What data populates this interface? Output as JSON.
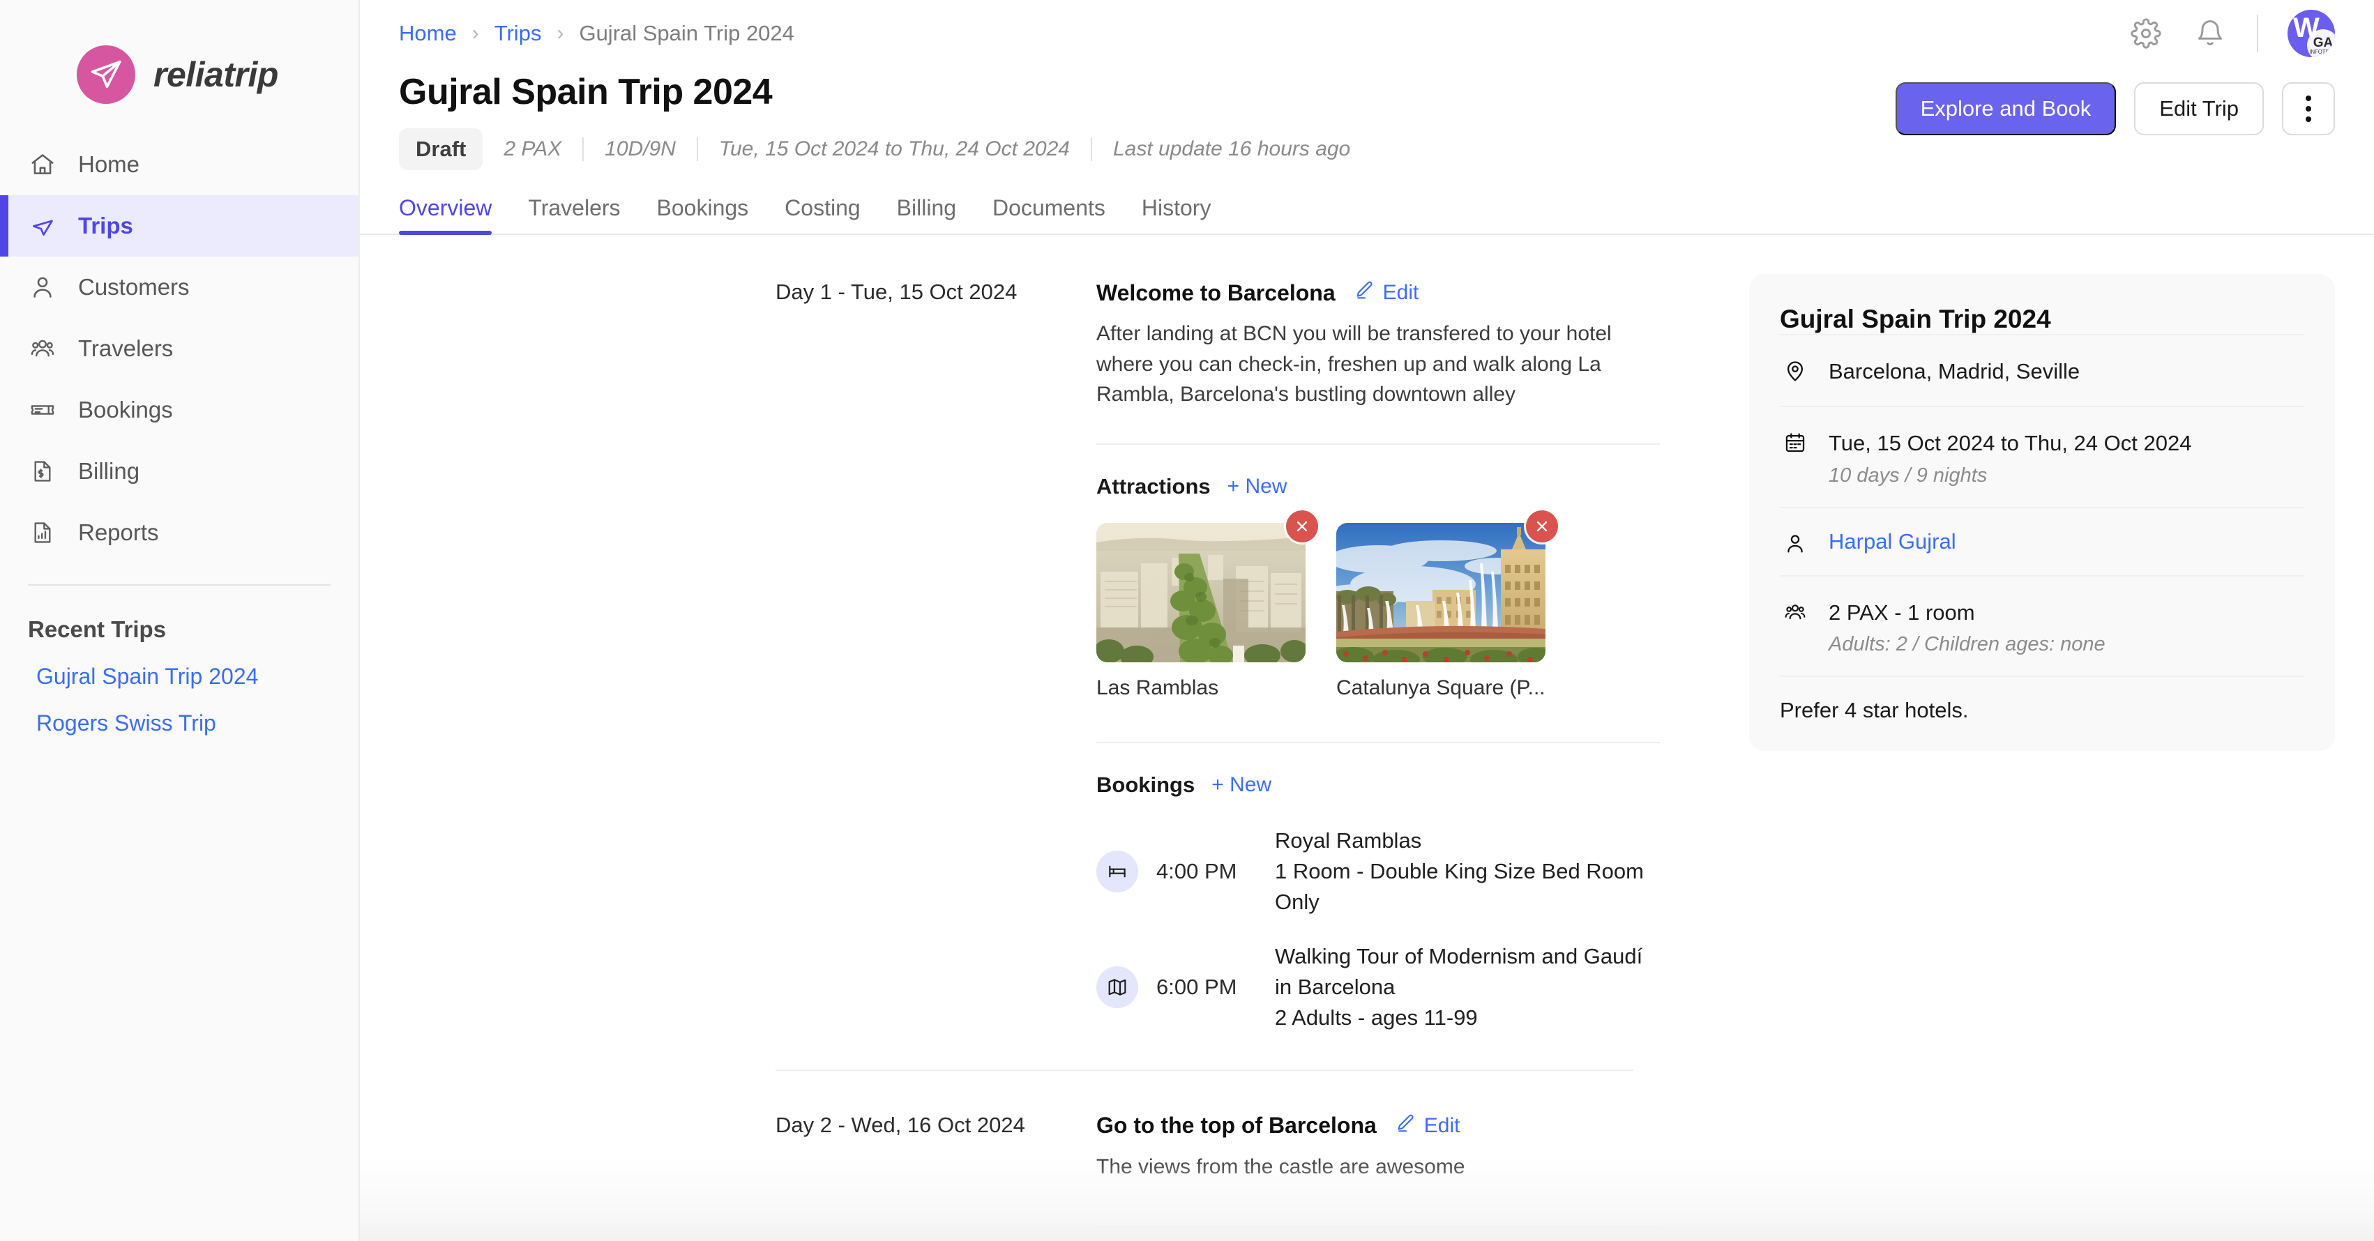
{
  "brand": {
    "name": "reliatrip",
    "logo_icon": "paper-plane-icon",
    "logo_color": "#d6579f"
  },
  "sidebar": {
    "nav": [
      {
        "label": "Home",
        "icon": "home-icon",
        "active": false
      },
      {
        "label": "Trips",
        "icon": "paper-plane-icon",
        "active": true
      },
      {
        "label": "Customers",
        "icon": "user-icon",
        "active": false
      },
      {
        "label": "Travelers",
        "icon": "users-group-icon",
        "active": false
      },
      {
        "label": "Bookings",
        "icon": "ticket-icon",
        "active": false
      },
      {
        "label": "Billing",
        "icon": "document-dollar-icon",
        "active": false
      },
      {
        "label": "Reports",
        "icon": "document-chart-icon",
        "active": false
      }
    ],
    "recent_title": "Recent Trips",
    "recent": [
      {
        "label": "Gujral Spain Trip 2024"
      },
      {
        "label": "Rogers Swiss Trip"
      }
    ]
  },
  "topbar": {
    "breadcrumb": [
      {
        "label": "Home",
        "link": true
      },
      {
        "label": "Trips",
        "link": true
      },
      {
        "label": "Gujral Spain Trip 2024",
        "link": false
      }
    ],
    "separator": "›",
    "settings_icon": "gear-icon",
    "notifications_icon": "bell-icon",
    "avatar_letter": "W",
    "avatar_badge_top": "GA",
    "avatar_badge_bottom": "INFOTECH",
    "avatar_color": "#6a5df0"
  },
  "header": {
    "title": "Gujral Spain Trip 2024",
    "status": "Draft",
    "meta": [
      "2 PAX",
      "10D/9N",
      "Tue, 15 Oct 2024 to Thu, 24 Oct 2024",
      "Last update 16 hours ago"
    ],
    "primary_action": "Explore and Book",
    "secondary_action": "Edit Trip",
    "more_action_icon": "kebab-menu-icon"
  },
  "tabs": [
    {
      "label": "Overview",
      "active": true
    },
    {
      "label": "Travelers",
      "active": false
    },
    {
      "label": "Bookings",
      "active": false
    },
    {
      "label": "Costing",
      "active": false
    },
    {
      "label": "Billing",
      "active": false
    },
    {
      "label": "Documents",
      "active": false
    },
    {
      "label": "History",
      "active": false
    }
  ],
  "itinerary": {
    "edit_label": "Edit",
    "new_label": "+ New",
    "attractions_label": "Attractions",
    "bookings_label": "Bookings",
    "days": [
      {
        "day_label": "Day 1 - Tue, 15 Oct 2024",
        "title": "Welcome to Barcelona",
        "description": "After landing at BCN you will be transfered to your hotel where you can check-in, freshen up and walk along La Rambla, Barcelona's bustling downtown alley",
        "attractions": [
          {
            "name": "Las Ramblas",
            "image": "las-ramblas-aerial-photo"
          },
          {
            "name": "Catalunya Square (P...",
            "image": "catalunya-square-fountain-photo"
          }
        ],
        "bookings": [
          {
            "icon": "bed-icon",
            "time": "4:00 PM",
            "title": "Royal Ramblas",
            "detail": "1 Room - Double King Size Bed Room Only"
          },
          {
            "icon": "map-icon",
            "time": "6:00 PM",
            "title": "Walking Tour of Modernism and Gaudí in Barcelona",
            "detail": "2 Adults - ages 11-99"
          }
        ]
      },
      {
        "day_label": "Day 2 - Wed, 16 Oct 2024",
        "title": "Go to the top of Barcelona",
        "description": "The views from the castle are awesome",
        "attractions": [],
        "bookings": []
      }
    ]
  },
  "trip_summary": {
    "title": "Gujral Spain Trip 2024",
    "destinations": "Barcelona, Madrid, Seville",
    "destinations_icon": "location-pin-icon",
    "dates": "Tue, 15 Oct 2024 to Thu, 24 Oct 2024",
    "duration": "10 days / 9 nights",
    "dates_icon": "calendar-icon",
    "customer": "Harpal Gujral",
    "customer_icon": "user-icon",
    "pax": "2 PAX - 1 room",
    "pax_detail": "Adults: 2 / Children ages: none",
    "pax_icon": "users-group-icon",
    "note": "Prefer 4 star hotels."
  }
}
